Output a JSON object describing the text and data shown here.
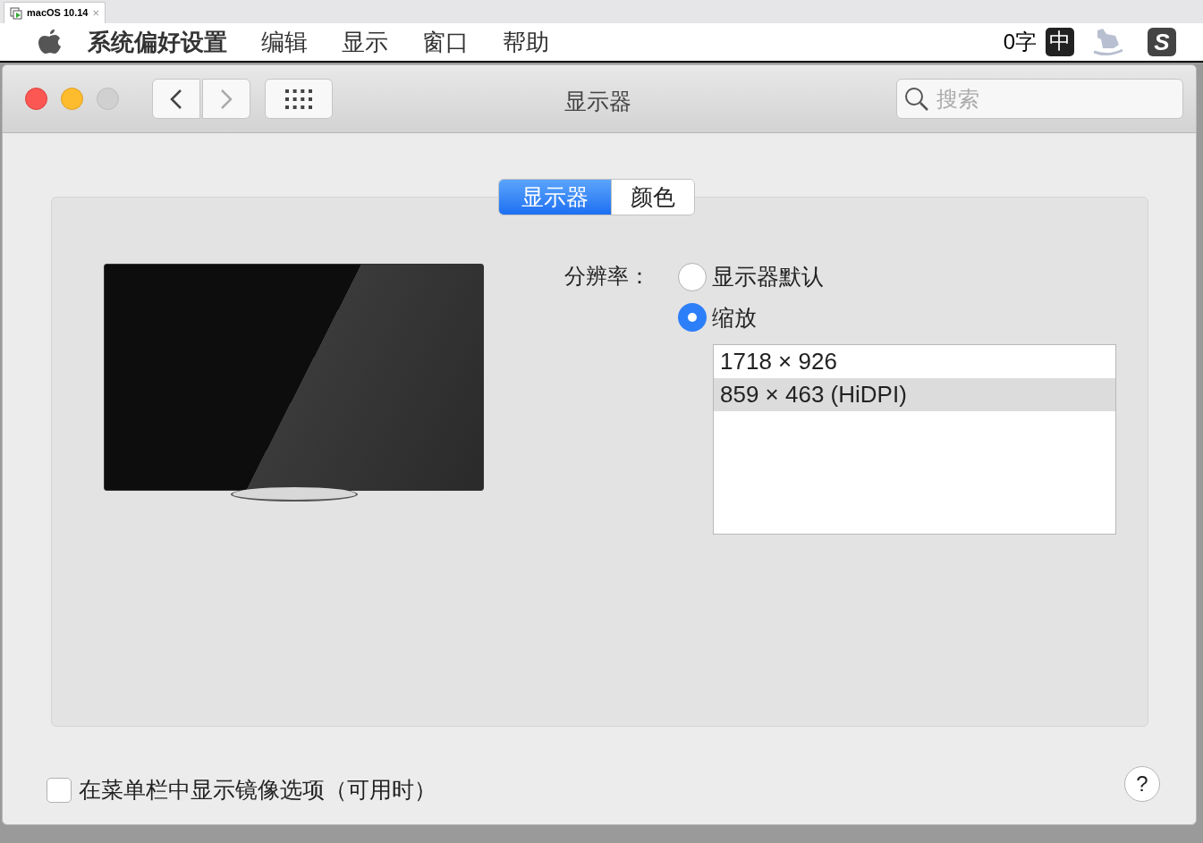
{
  "host_tab": {
    "title": "macOS 10.14",
    "close": "×"
  },
  "menu_bar": {
    "items": [
      "系统偏好设置",
      "编辑",
      "显示",
      "窗口",
      "帮助"
    ],
    "word_count": "0字",
    "input_mode": "中",
    "input_logo": "S"
  },
  "window": {
    "title": "显示器",
    "search": {
      "placeholder": "搜索"
    }
  },
  "tabs": [
    {
      "label": "显示器",
      "selected": true
    },
    {
      "label": "颜色",
      "selected": false
    }
  ],
  "resolution_label": "分辨率：",
  "resolution_options": [
    {
      "label": "显示器默认",
      "selected": false
    },
    {
      "label": "缩放",
      "selected": true
    }
  ],
  "resolutions": [
    {
      "label": "1718 × 926",
      "selected": false
    },
    {
      "label": "859 × 463 (HiDPI)",
      "selected": true
    }
  ],
  "mirror_option": {
    "label": "在菜单栏中显示镜像选项（可用时）",
    "checked": false
  },
  "help": "?"
}
